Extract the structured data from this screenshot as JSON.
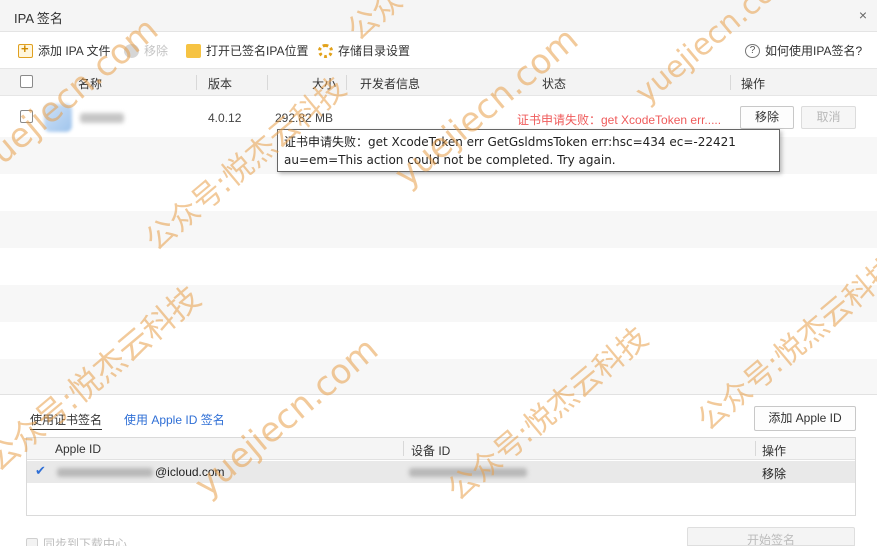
{
  "window": {
    "title": "IPA 签名",
    "close_glyph": "×"
  },
  "toolbar": {
    "add_ipa": "添加 IPA 文件",
    "disabled_item": "移除",
    "open_folder": "打开已签名IPA位置",
    "storage_settings": "存储目录设置",
    "help": "如何使用IPA签名?"
  },
  "columns": {
    "name": "名称",
    "version": "版本",
    "size": "大小",
    "developer": "开发者信息",
    "status": "状态",
    "actions": "操作"
  },
  "ipa_rows": [
    {
      "version": "4.0.12",
      "size": "292.82 MB",
      "status": "证书申请失败：get XcodeToken err.....",
      "remove_label": "移除",
      "cancel_label": "取消"
    }
  ],
  "tooltip": {
    "text": "证书申请失败：get XcodeToken err GetGsldmsToken err:hsc=434 ec=-22421 au=em=This action could not be completed. Try again."
  },
  "sign_options": {
    "tab_cert": "使用证书签名",
    "tab_apple_id": "使用 Apple ID 签名",
    "add_apple_id": "添加 Apple ID"
  },
  "account_table": {
    "col_apple_id": "Apple ID",
    "col_device_id": "设备 ID",
    "col_actions": "操作",
    "rows": [
      {
        "apple_id_suffix": "@icloud.com",
        "action": "移除",
        "selected": true
      }
    ]
  },
  "footer": {
    "sync_label": "同步到下载中心",
    "start_sign": "开始签名"
  },
  "watermark": {
    "domain": "yuejiecn.com",
    "brand": "公众号:悦杰云科技",
    "color": "#e89e48"
  },
  "colors": {
    "error": "#ef5b5b",
    "link": "#2f6fd6",
    "header_bg": "#f3f3f3"
  },
  "icons": [
    "add-file-icon",
    "disabled-circle-icon",
    "folder-icon",
    "gear-icon",
    "help-icon",
    "close-icon",
    "check-icon"
  ]
}
